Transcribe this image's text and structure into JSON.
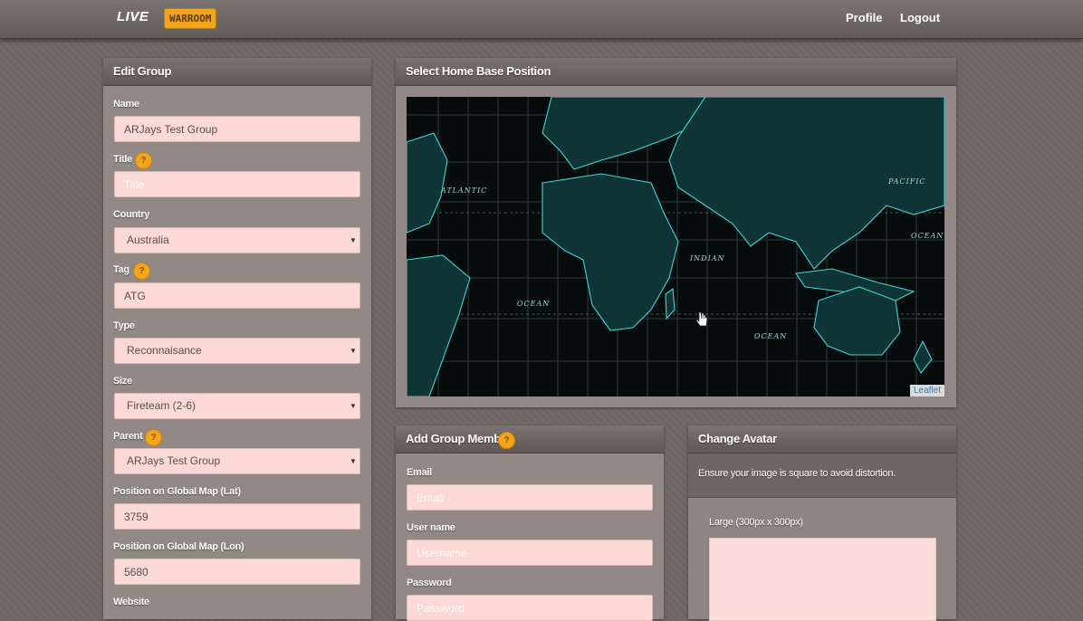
{
  "brand": {
    "live": "LIVE",
    "warroom": "WARROOM"
  },
  "nav": {
    "profile": "Profile",
    "logout": "Logout"
  },
  "edit_group": {
    "title": "Edit Group",
    "name_label": "Name",
    "name_value": "ARJays Test Group",
    "title_label": "Title",
    "title_placeholder": "Title",
    "country_label": "Country",
    "country_value": "Australia",
    "tag_label": "Tag",
    "tag_value": "ATG",
    "type_label": "Type",
    "type_value": "Reconnaisance",
    "size_label": "Size",
    "size_value": "Fireteam (2-6)",
    "parent_label": "Parent",
    "parent_value": "ARJays Test Group",
    "lat_label": "Position on Global Map (Lat)",
    "lat_value": "3759",
    "lon_label": "Position on Global Map (Lon)",
    "lon_value": "5680",
    "website_label": "Website"
  },
  "map_panel": {
    "title": "Select Home Base Position",
    "labels": {
      "atlantic": "ATLANTIC",
      "pacific": "PACIFIC",
      "indian": "INDIAN",
      "ocean_sw": "OCEAN",
      "ocean_s": "OCEAN",
      "ocean_e": "OCEAN"
    },
    "attribution": "Leaflet"
  },
  "add_member": {
    "title": "Add Group Member",
    "email_label": "Email",
    "email_placeholder": "Email",
    "username_label": "User name",
    "username_placeholder": "Username",
    "password_label": "Password",
    "password_placeholder": "Password"
  },
  "avatar": {
    "title": "Change Avatar",
    "hint": "Ensure your image is square to avoid distortion.",
    "large_label": "Large (300px x 300px)"
  },
  "colors": {
    "accent": "#f2a51c",
    "field_bg": "#fad9d6",
    "map_line": "#3fd6d8"
  }
}
